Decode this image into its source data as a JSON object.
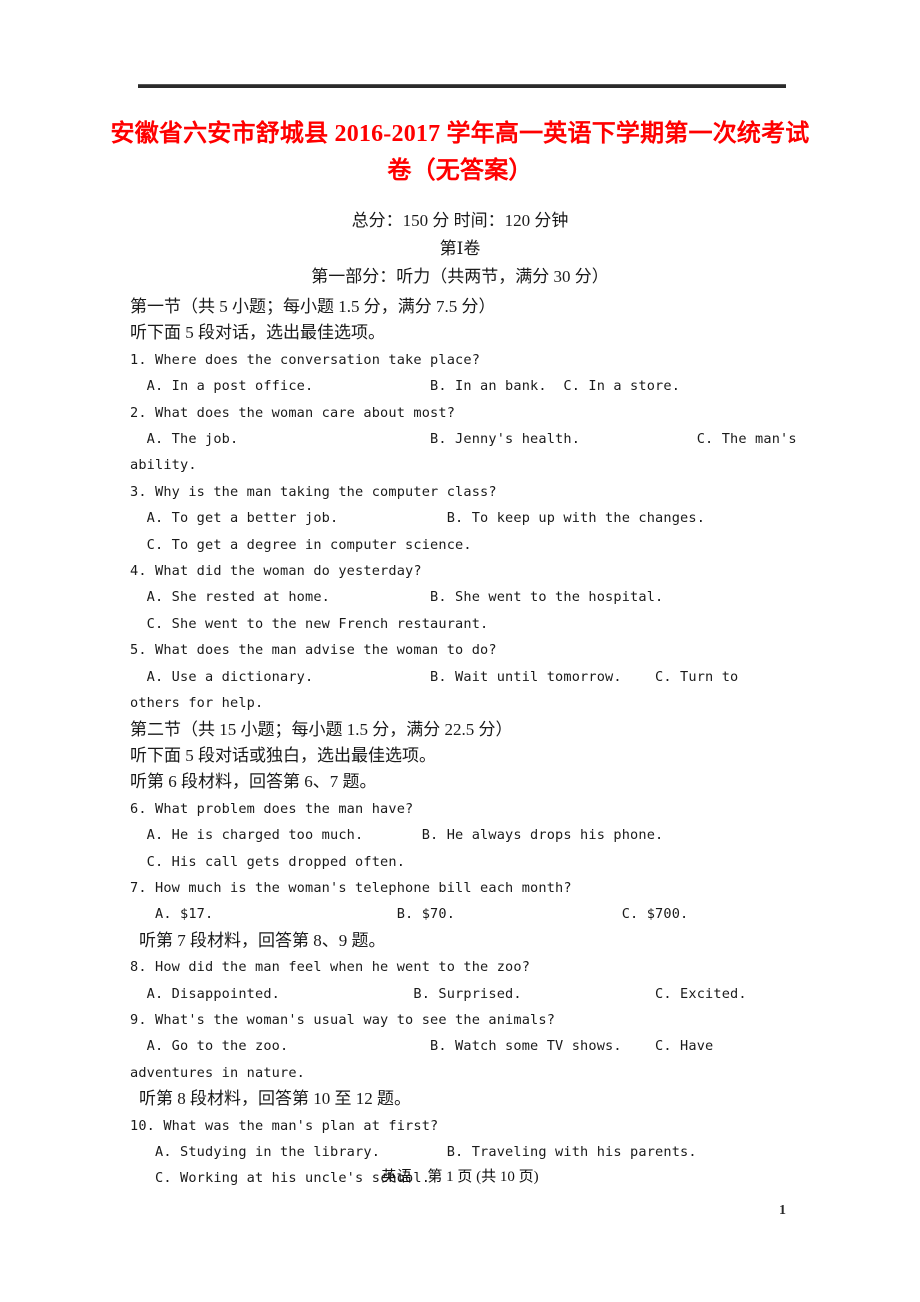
{
  "document": {
    "title_lines": [
      "安徽省六安市舒城县 2016-2017 学年高一英语下学期第一次统考试",
      "卷（无答案）"
    ],
    "title_color": "#ff0000",
    "score_line": "总分：150 分   时间：120 分钟",
    "paper_label": "第Ⅰ卷",
    "part_one_header": "第一部分：听力（共两节，满分 30 分）"
  },
  "section_one": {
    "header": "第一节（共 5 小题；每小题 1.5 分，满分 7.5 分）",
    "instruction": "听下面 5 段对话，选出最佳选项。",
    "questions": [
      {
        "stem": "1. Where does the conversation take place?",
        "rows": [
          "  A. In a post office.              B. In an bank.  C. In a store."
        ]
      },
      {
        "stem": "2. What does the woman care about most?",
        "rows": [
          "  A. The job.                       B. Jenny's health.              C. The man's",
          "ability."
        ]
      },
      {
        "stem": "3. Why is the man taking the computer class?",
        "rows": [
          "  A. To get a better job.             B. To keep up with the changes.",
          "  C. To get a degree in computer science."
        ]
      },
      {
        "stem": "4. What did the woman do yesterday?",
        "rows": [
          "  A. She rested at home.            B. She went to the hospital.",
          "  C. She went to the new French restaurant."
        ]
      },
      {
        "stem": "5. What does the man advise the woman to do?",
        "rows": [
          "  A. Use a dictionary.              B. Wait until tomorrow.    C. Turn to",
          "others for help."
        ]
      }
    ]
  },
  "section_two": {
    "header": "第二节（共 15 小题；每小题 1.5 分，满分 22.5 分）",
    "instruction": "听下面 5 段对话或独白，选出最佳选项。",
    "material_6": "听第 6 段材料，回答第 6、7 题。",
    "material_7": "听第 7 段材料，回答第 8、9 题。",
    "material_8": "听第 8 段材料，回答第 10 至 12 题。",
    "questions": [
      {
        "stem": "6. What problem does the man have?",
        "rows": [
          "  A. He is charged too much.       B. He always drops his phone.",
          "  C. His call gets dropped often."
        ]
      },
      {
        "stem": "7. How much is the woman's telephone bill each month?",
        "rows": [
          "   A. $17.                      B. $70.                    C. $700."
        ]
      },
      {
        "stem": "8. How did the man feel when he went to the zoo?",
        "rows": [
          "  A. Disappointed.                B. Surprised.                C. Excited."
        ]
      },
      {
        "stem": "9. What's the woman's usual way to see the animals?",
        "rows": [
          "  A. Go to the zoo.                 B. Watch some TV shows.    C. Have",
          "adventures in nature."
        ]
      },
      {
        "stem": "10. What was the man's plan at first?",
        "rows": [
          "   A. Studying in the library.        B. Traveling with his parents.",
          "   C. Working at his uncle's school."
        ]
      }
    ]
  },
  "footer": {
    "subject": "英语",
    "page_text": "第 1 页 (共 10 页)",
    "page_number": "1"
  }
}
